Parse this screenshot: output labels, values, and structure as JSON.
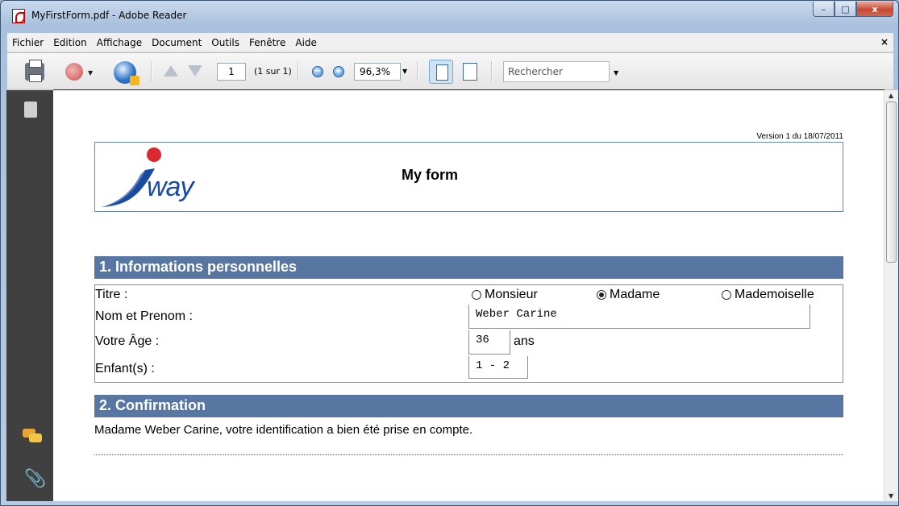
{
  "window": {
    "title": "MyFirstForm.pdf - Adobe Reader",
    "minimize": "–",
    "maximize": "□",
    "close": "x"
  },
  "menu": {
    "items": [
      "Fichier",
      "Edition",
      "Affichage",
      "Document",
      "Outils",
      "Fenêtre",
      "Aide"
    ],
    "close": "×"
  },
  "toolbar": {
    "page_value": "1",
    "page_count": "(1 sur 1)",
    "zoom_value": "96,3%",
    "zoom_out": "−",
    "zoom_in": "+",
    "search_placeholder": "Rechercher",
    "caret": "▼"
  },
  "document": {
    "version": "Version 1 du 18/07/2011",
    "logo_text": "way",
    "form_title": "My form",
    "section1_title": "1. Informations personnelles",
    "titre_label": "Titre :",
    "radio_options": [
      {
        "label": "Monsieur",
        "selected": false
      },
      {
        "label": "Madame",
        "selected": true
      },
      {
        "label": "Mademoiselle",
        "selected": false
      }
    ],
    "nom_label": "Nom et Prenom :",
    "nom_value": "Weber Carine",
    "age_label": "Votre Âge :",
    "age_value": "36",
    "age_unit": "ans",
    "enfants_label": "Enfant(s) :",
    "enfants_value": "1 - 2",
    "section2_title": "2. Confirmation",
    "confirmation_text": "Madame Weber Carine, votre identification a bien été prise en compte."
  },
  "colors": {
    "section_bar": "#5776a2",
    "header_border": "#6787b0",
    "logo_blue": "#1a4aa0",
    "logo_red": "#d9282f",
    "sidenav": "#404040"
  }
}
